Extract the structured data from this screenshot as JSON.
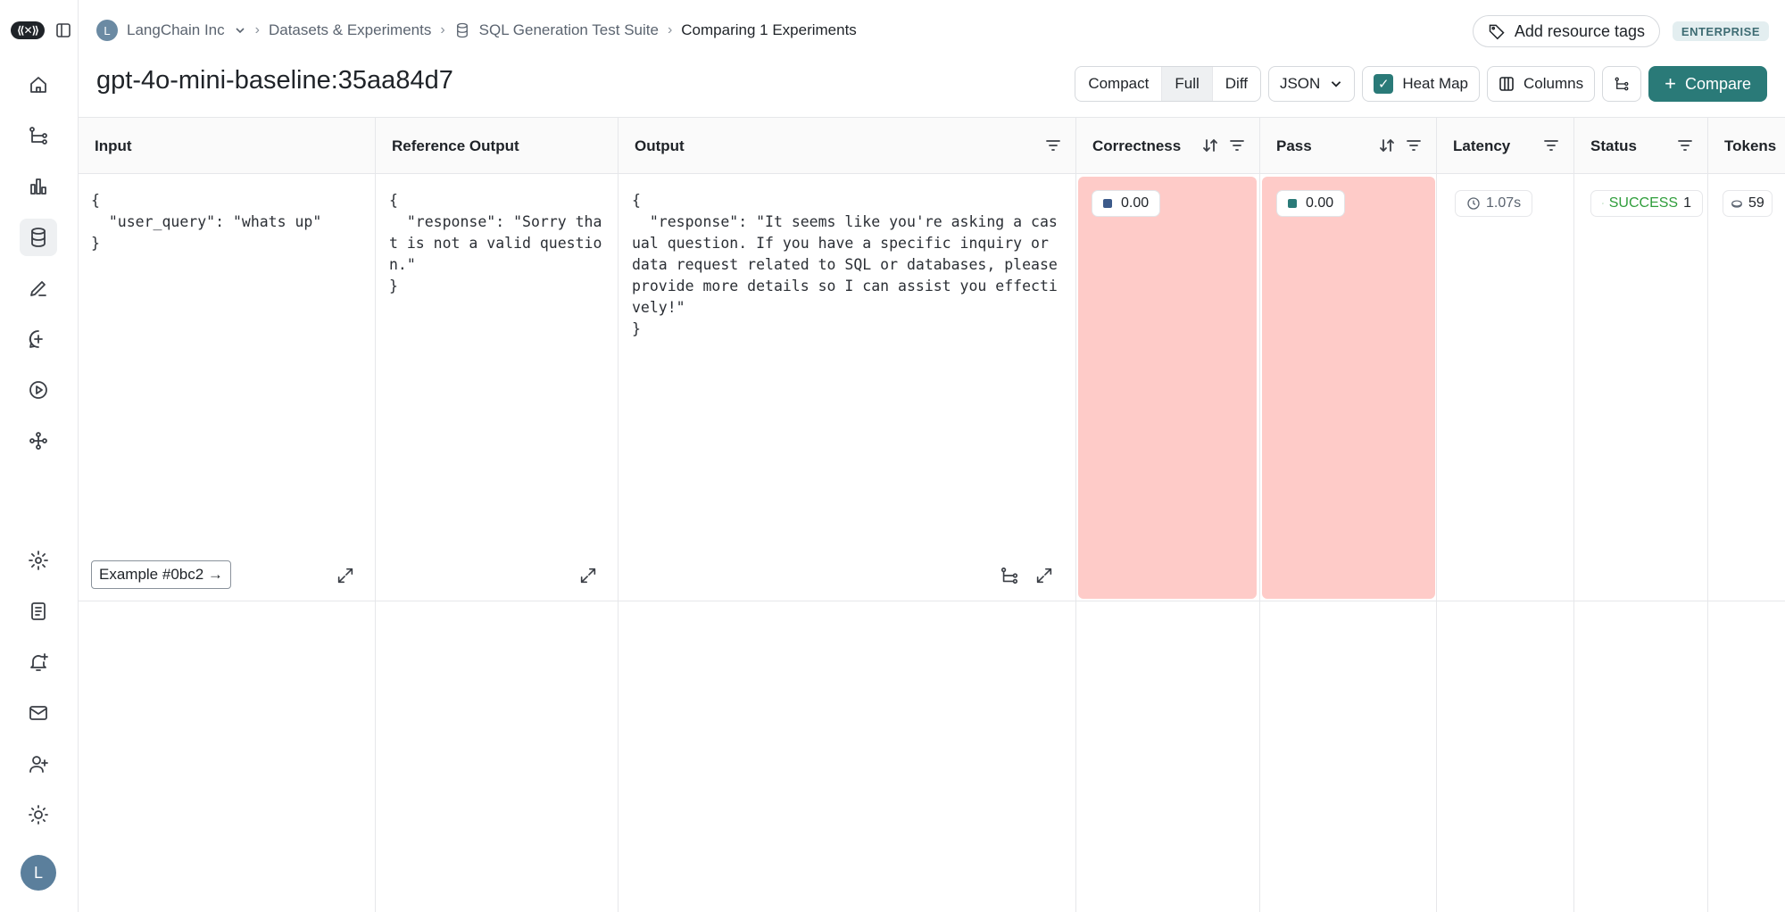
{
  "breadcrumb": {
    "org_initial": "L",
    "org": "LangChain Inc",
    "section": "Datasets & Experiments",
    "dataset": "SQL Generation Test Suite",
    "current": "Comparing 1 Experiments"
  },
  "header": {
    "tags_label": "Add resource tags",
    "plan_badge": "ENTERPRISE",
    "title": "gpt-4o-mini-baseline:35aa84d7"
  },
  "toolbar": {
    "view_modes": [
      "Compact",
      "Full",
      "Diff"
    ],
    "active_view": "Full",
    "format": "JSON",
    "heatmap_label": "Heat Map",
    "heatmap_checked": true,
    "columns_label": "Columns",
    "compare_label": "Compare",
    "accent_color": "#2a7a78"
  },
  "table": {
    "columns": [
      "Input",
      "Reference Output",
      "Output",
      "Correctness",
      "Pass",
      "Latency",
      "Status",
      "Tokens"
    ],
    "rows": [
      {
        "input": "{\n  \"user_query\": \"whats up\"\n}",
        "reference_output": "{\n  \"response\": \"Sorry that is not a valid question.\"\n}",
        "output": "{\n  \"response\": \"It seems like you're asking a casual question. If you have a specific inquiry or data request related to SQL or databases, please provide more details so I can assist you effectively!\"\n}",
        "correctness": "0.00",
        "pass": "0.00",
        "latency": "1.07s",
        "status": "SUCCESS",
        "status_extra": "1",
        "tokens": "59",
        "example_label": "Example #0bc2 →",
        "heat_color": "#fecbc8"
      }
    ]
  },
  "sidebar": {
    "items": [
      "home-icon",
      "tracing-icon",
      "chart-icon",
      "database-icon",
      "pen-icon",
      "chat-plus-icon",
      "play-icon",
      "graph-icon",
      "gear-icon",
      "doc-icon",
      "bell-plus-icon",
      "mail-icon",
      "user-plus-icon",
      "sun-icon"
    ],
    "user_initial": "L"
  }
}
